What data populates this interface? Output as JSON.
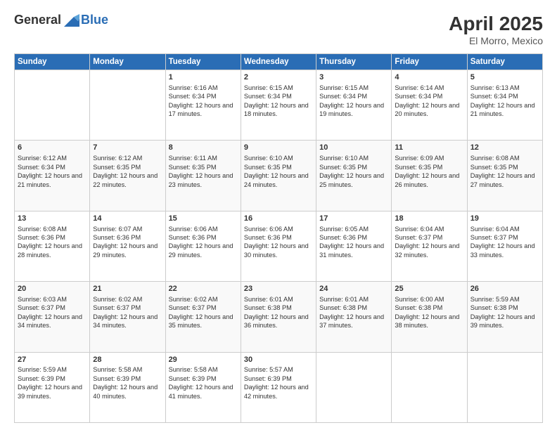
{
  "logo": {
    "general": "General",
    "blue": "Blue"
  },
  "title": "April 2025",
  "location": "El Morro, Mexico",
  "days_of_week": [
    "Sunday",
    "Monday",
    "Tuesday",
    "Wednesday",
    "Thursday",
    "Friday",
    "Saturday"
  ],
  "weeks": [
    [
      {
        "day": "",
        "content": ""
      },
      {
        "day": "",
        "content": ""
      },
      {
        "day": "1",
        "content": "Sunrise: 6:16 AM\nSunset: 6:34 PM\nDaylight: 12 hours and 17 minutes."
      },
      {
        "day": "2",
        "content": "Sunrise: 6:15 AM\nSunset: 6:34 PM\nDaylight: 12 hours and 18 minutes."
      },
      {
        "day": "3",
        "content": "Sunrise: 6:15 AM\nSunset: 6:34 PM\nDaylight: 12 hours and 19 minutes."
      },
      {
        "day": "4",
        "content": "Sunrise: 6:14 AM\nSunset: 6:34 PM\nDaylight: 12 hours and 20 minutes."
      },
      {
        "day": "5",
        "content": "Sunrise: 6:13 AM\nSunset: 6:34 PM\nDaylight: 12 hours and 21 minutes."
      }
    ],
    [
      {
        "day": "6",
        "content": "Sunrise: 6:12 AM\nSunset: 6:34 PM\nDaylight: 12 hours and 21 minutes."
      },
      {
        "day": "7",
        "content": "Sunrise: 6:12 AM\nSunset: 6:35 PM\nDaylight: 12 hours and 22 minutes."
      },
      {
        "day": "8",
        "content": "Sunrise: 6:11 AM\nSunset: 6:35 PM\nDaylight: 12 hours and 23 minutes."
      },
      {
        "day": "9",
        "content": "Sunrise: 6:10 AM\nSunset: 6:35 PM\nDaylight: 12 hours and 24 minutes."
      },
      {
        "day": "10",
        "content": "Sunrise: 6:10 AM\nSunset: 6:35 PM\nDaylight: 12 hours and 25 minutes."
      },
      {
        "day": "11",
        "content": "Sunrise: 6:09 AM\nSunset: 6:35 PM\nDaylight: 12 hours and 26 minutes."
      },
      {
        "day": "12",
        "content": "Sunrise: 6:08 AM\nSunset: 6:35 PM\nDaylight: 12 hours and 27 minutes."
      }
    ],
    [
      {
        "day": "13",
        "content": "Sunrise: 6:08 AM\nSunset: 6:36 PM\nDaylight: 12 hours and 28 minutes."
      },
      {
        "day": "14",
        "content": "Sunrise: 6:07 AM\nSunset: 6:36 PM\nDaylight: 12 hours and 29 minutes."
      },
      {
        "day": "15",
        "content": "Sunrise: 6:06 AM\nSunset: 6:36 PM\nDaylight: 12 hours and 29 minutes."
      },
      {
        "day": "16",
        "content": "Sunrise: 6:06 AM\nSunset: 6:36 PM\nDaylight: 12 hours and 30 minutes."
      },
      {
        "day": "17",
        "content": "Sunrise: 6:05 AM\nSunset: 6:36 PM\nDaylight: 12 hours and 31 minutes."
      },
      {
        "day": "18",
        "content": "Sunrise: 6:04 AM\nSunset: 6:37 PM\nDaylight: 12 hours and 32 minutes."
      },
      {
        "day": "19",
        "content": "Sunrise: 6:04 AM\nSunset: 6:37 PM\nDaylight: 12 hours and 33 minutes."
      }
    ],
    [
      {
        "day": "20",
        "content": "Sunrise: 6:03 AM\nSunset: 6:37 PM\nDaylight: 12 hours and 34 minutes."
      },
      {
        "day": "21",
        "content": "Sunrise: 6:02 AM\nSunset: 6:37 PM\nDaylight: 12 hours and 34 minutes."
      },
      {
        "day": "22",
        "content": "Sunrise: 6:02 AM\nSunset: 6:37 PM\nDaylight: 12 hours and 35 minutes."
      },
      {
        "day": "23",
        "content": "Sunrise: 6:01 AM\nSunset: 6:38 PM\nDaylight: 12 hours and 36 minutes."
      },
      {
        "day": "24",
        "content": "Sunrise: 6:01 AM\nSunset: 6:38 PM\nDaylight: 12 hours and 37 minutes."
      },
      {
        "day": "25",
        "content": "Sunrise: 6:00 AM\nSunset: 6:38 PM\nDaylight: 12 hours and 38 minutes."
      },
      {
        "day": "26",
        "content": "Sunrise: 5:59 AM\nSunset: 6:38 PM\nDaylight: 12 hours and 39 minutes."
      }
    ],
    [
      {
        "day": "27",
        "content": "Sunrise: 5:59 AM\nSunset: 6:39 PM\nDaylight: 12 hours and 39 minutes."
      },
      {
        "day": "28",
        "content": "Sunrise: 5:58 AM\nSunset: 6:39 PM\nDaylight: 12 hours and 40 minutes."
      },
      {
        "day": "29",
        "content": "Sunrise: 5:58 AM\nSunset: 6:39 PM\nDaylight: 12 hours and 41 minutes."
      },
      {
        "day": "30",
        "content": "Sunrise: 5:57 AM\nSunset: 6:39 PM\nDaylight: 12 hours and 42 minutes."
      },
      {
        "day": "",
        "content": ""
      },
      {
        "day": "",
        "content": ""
      },
      {
        "day": "",
        "content": ""
      }
    ]
  ]
}
